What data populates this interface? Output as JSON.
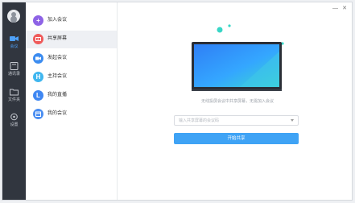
{
  "window": {
    "minimize": "—",
    "close": "✕"
  },
  "rail": {
    "items": [
      {
        "label": "会议",
        "icon": "video-camera-icon",
        "active": true
      },
      {
        "label": "通讯录",
        "icon": "contacts-icon",
        "active": false
      },
      {
        "label": "文件夹",
        "icon": "folder-icon",
        "active": false
      },
      {
        "label": "设置",
        "icon": "gear-icon",
        "active": false
      }
    ]
  },
  "menu": {
    "items": [
      {
        "label": "加入会议",
        "icon": "plus-icon",
        "color": "#8e63e6",
        "glyph": "+"
      },
      {
        "label": "共享屏幕",
        "icon": "share-screen-icon",
        "color": "#ef5a5a",
        "glyph": "⬆"
      },
      {
        "label": "发起会议",
        "icon": "video-icon",
        "color": "#3c8cf0",
        "glyph": "■"
      },
      {
        "label": "主持会议",
        "icon": "host-icon",
        "color": "#3fb6ef",
        "glyph": "H"
      },
      {
        "label": "我的直播",
        "icon": "live-icon",
        "color": "#3f87f2",
        "glyph": "L"
      },
      {
        "label": "我的会议",
        "icon": "calendar-icon",
        "color": "#4a8ef2",
        "glyph": "▦"
      }
    ],
    "active_index": 1
  },
  "main": {
    "hint": "无线投屏会议中共享屏幕，无需加入会议",
    "select_placeholder": "输入共享屏幕的会议码",
    "start_button": "开始共享"
  },
  "colors": {
    "accent": "#3fa3f5",
    "rail_bg": "#31363f",
    "screen_gradient_start": "#3aa0ff",
    "screen_gradient_end": "#3ad8cf"
  }
}
